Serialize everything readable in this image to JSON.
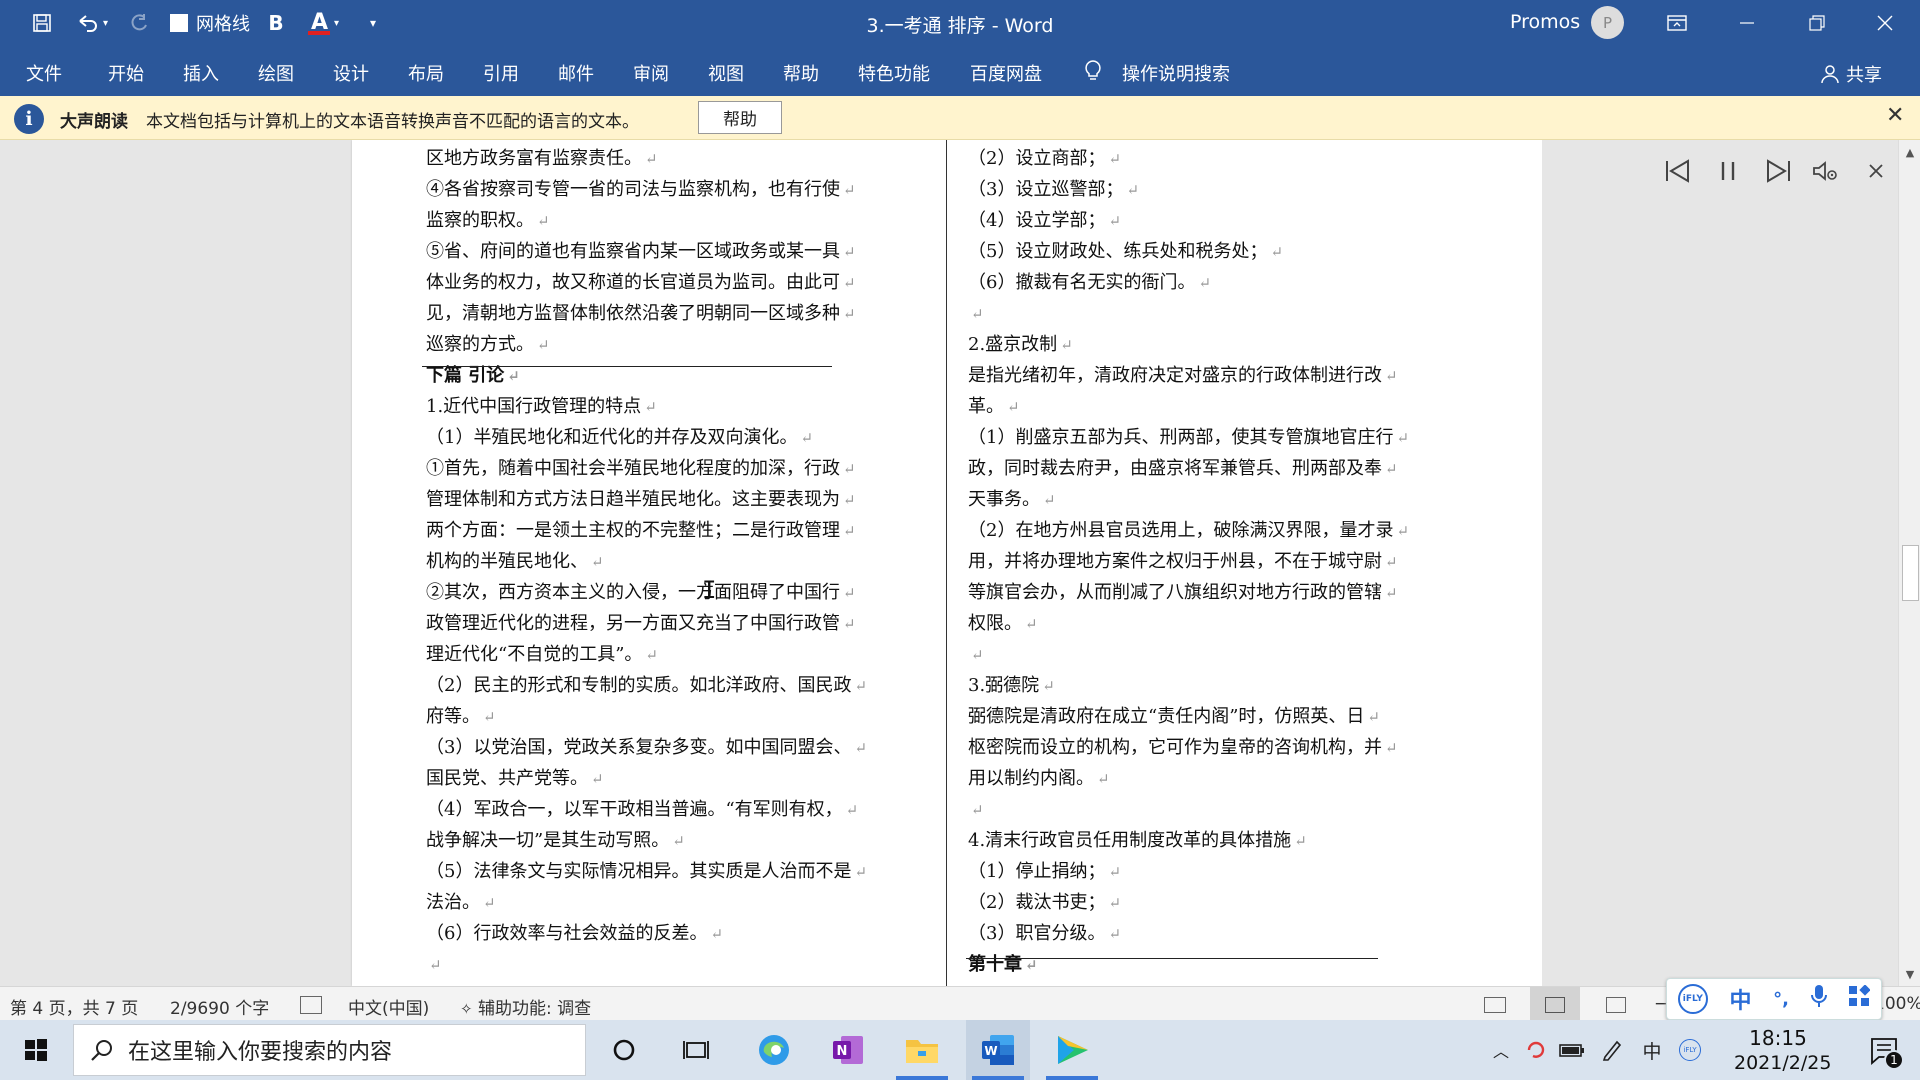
{
  "window": {
    "title": "3.一考通 排序  -  Word",
    "user_name": "Promos",
    "avatar_initial": "P",
    "quick_access": {
      "gridlines_label": "网格线",
      "bold_label": "B",
      "font_color_label": "A"
    }
  },
  "ribbon": {
    "tabs": [
      "文件",
      "开始",
      "插入",
      "绘图",
      "设计",
      "布局",
      "引用",
      "邮件",
      "审阅",
      "视图",
      "帮助",
      "特色功能",
      "百度网盘",
      "操作说明搜索"
    ],
    "share_label": "共享"
  },
  "message_bar": {
    "title": "大声朗读",
    "text": "本文档包括与计算机上的文本语音转换声音不匹配的语言的文本。",
    "help_button": "帮助"
  },
  "document": {
    "left_column": [
      "区地方政务富有监察责任。",
      "④各省按察司专管一省的司法与监察机构，也有行使",
      "监察的职权。",
      "⑤省、府间的道也有监察省内某一区域政务或某一具",
      "体业务的权力，故又称道的长官道员为监司。由此可",
      "见，清朝地方监督体制依然沿袭了明朝同一区域多种",
      "巡察的方式。",
      "下篇  引论",
      "1.近代中国行政管理的特点",
      "（1）半殖民地化和近代化的并存及双向演化。",
      "①首先，随着中国社会半殖民地化程度的加深，行政",
      "管理体制和方式方法日趋半殖民地化。这主要表现为",
      "两个方面：一是领土主权的不完整性；二是行政管理",
      "机构的半殖民地化、",
      "②其次，西方资本主义的入侵，一方面阻碍了中国行",
      "政管理近代化的进程，另一方面又充当了中国行政管",
      "理近代化“不自觉的工具”。",
      "（2）民主的形式和专制的实质。如北洋政府、国民政",
      "府等。",
      "（3）以党治国，党政关系复杂多变。如中国同盟会、",
      "国民党、共产党等。",
      "（4）军政合一，以军干政相当普遍。“有军则有权，",
      "战争解决一切”是其生动写照。",
      "（5）法律条文与实际情况相异。其实质是人治而不是",
      "法治。",
      "（6）行政效率与社会效益的反差。",
      ""
    ],
    "right_column": [
      "（2）设立商部；",
      "（3）设立巡警部；",
      "（4）设立学部；",
      "（5）设立财政处、练兵处和税务处；",
      "（6）撤裁有名无实的衙门。",
      "",
      "2.盛京改制",
      "是指光绪初年，清政府决定对盛京的行政体制进行改",
      "革。",
      "（1）削盛京五部为兵、刑两部，使其专管旗地官庄行",
      "政，同时裁去府尹，由盛京将军兼管兵、刑两部及奉",
      "天事务。",
      "（2）在地方州县官员选用上，破除满汉界限，量才录",
      "用，并将办理地方案件之权归于州县，不在于城守尉",
      "等旗官会办，从而削减了八旗组织对地方行政的管辖",
      "权限。",
      "",
      "3.弼德院",
      "弼德院是清政府在成立“责任内阁”时，仿照英、日",
      "枢密院而设立的机构，它可作为皇帝的咨询机构，并",
      "用以制约内阁。",
      "",
      "4.清末行政官员任用制度改革的具体措施",
      "（1）停止捐纳；",
      "（2）裁汰书吏；",
      "（3）职官分级。",
      "第十章"
    ],
    "paragraph_mark": "↵"
  },
  "status_bar": {
    "page": "第 4 页，共 7 页",
    "words": "2/9690 个字",
    "language": "中文(中国)",
    "accessibility": "辅助功能: 调查",
    "zoom": "100%"
  },
  "ime_toolbar": {
    "chinese_label": "中"
  },
  "taskbar": {
    "search_placeholder": "在这里输入你要搜索的内容",
    "time": "18:15",
    "date": "2021/2/25",
    "input_label": "中",
    "notification_count": "1"
  },
  "colors": {
    "word_blue": "#2b579a",
    "message_bar": "#fff4ce",
    "taskbar": "#d9e3ee",
    "spell_underline": "#e02020",
    "grammar_underline": "#3b5fc0"
  },
  "icons": [
    "save-icon",
    "undo-icon",
    "redo-icon",
    "lightbulb-icon",
    "person-icon",
    "info-icon",
    "prev-paragraph-icon",
    "pause-icon",
    "next-paragraph-icon",
    "voice-settings-icon",
    "windows-start-icon",
    "search-icon",
    "cortana-icon",
    "task-view-icon",
    "edge-icon",
    "onenote-icon",
    "file-explorer-icon",
    "word-icon",
    "video-app-icon"
  ]
}
